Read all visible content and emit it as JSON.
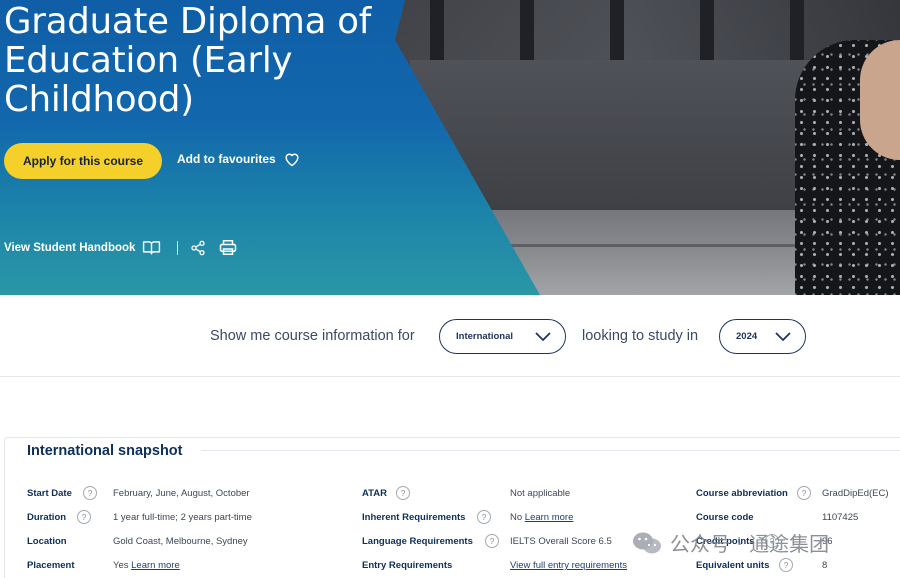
{
  "hero": {
    "title": "Graduate Diploma of Education (Early Childhood)",
    "apply_label": "Apply for this course",
    "favourites_label": "Add to favourites",
    "handbook_label": "View Student Handbook"
  },
  "selector": {
    "prefix": "Show me course information for",
    "audience": "International",
    "middle": "looking to study in",
    "year": "2024"
  },
  "snapshot": {
    "title": "International snapshot",
    "col1": [
      {
        "label": "Start Date",
        "value": "February, June, August, October",
        "help": true
      },
      {
        "label": "Duration",
        "value": "1 year full-time; 2 years part-time",
        "help": true
      },
      {
        "label": "Location",
        "value": "Gold Coast, Melbourne, Sydney",
        "help": false
      },
      {
        "label": "Placement",
        "value": "Yes",
        "link": "Learn more",
        "help": false
      }
    ],
    "col2": [
      {
        "label": "ATAR",
        "value": "Not applicable",
        "help": true
      },
      {
        "label": "Inherent Requirements",
        "value": "No",
        "link": "Learn more",
        "help": true
      },
      {
        "label": "Language Requirements",
        "value": "IELTS Overall Score 6.5",
        "help": true
      },
      {
        "label": "Entry Requirements",
        "link": "View full entry requirements",
        "help": false
      }
    ],
    "col3": [
      {
        "label": "Course abbreviation",
        "value": "GradDipEd(EC)",
        "help": true
      },
      {
        "label": "Course code",
        "value": "1107425",
        "help": false
      },
      {
        "label": "Credit points",
        "value": "96",
        "help": true
      },
      {
        "label": "Equivalent units",
        "value": "8",
        "help": true
      }
    ],
    "help_glyph": "?"
  },
  "watermark": {
    "text": "公众号 · 通途集团"
  },
  "colors": {
    "brand_blue": "#0f5ea7",
    "accent_yellow": "#f5cf2a",
    "navy": "#0e2f5a"
  }
}
